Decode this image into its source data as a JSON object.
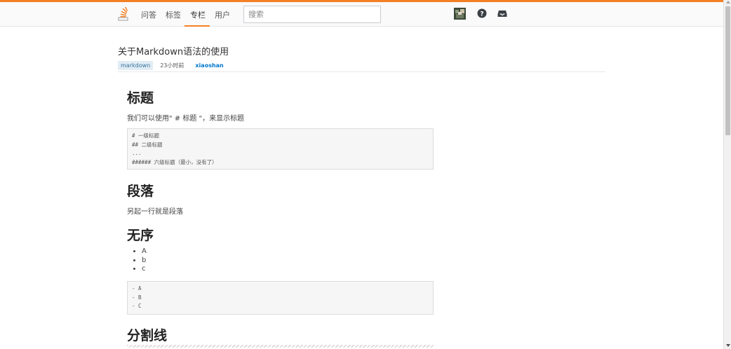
{
  "header": {
    "nav": [
      "问答",
      "标签",
      "专栏",
      "用户"
    ],
    "active_nav": "专栏",
    "search_placeholder": "搜索",
    "icons": [
      "logo-icon",
      "avatar",
      "help-icon",
      "inbox-icon"
    ],
    "accent_color": "#f48024"
  },
  "post": {
    "title": "关于Markdown语法的使用",
    "tag": "markdown",
    "time": "23小时前",
    "author": "xiaoshan"
  },
  "sections": {
    "heading": {
      "title": "标题",
      "text": "我们可以使用\" # 标题 \"，来显示标题",
      "code": [
        "# 一级标题",
        "## 二级标题",
        "...",
        "###### 六级标题（最小，没有了）"
      ]
    },
    "paragraph": {
      "title": "段落",
      "text": "另起一行就是段落"
    },
    "unordered": {
      "title": "无序",
      "items": [
        "A",
        "b",
        "c"
      ],
      "code": [
        "- A",
        "- B",
        "- C"
      ]
    },
    "divider": {
      "title": "分割线"
    }
  }
}
